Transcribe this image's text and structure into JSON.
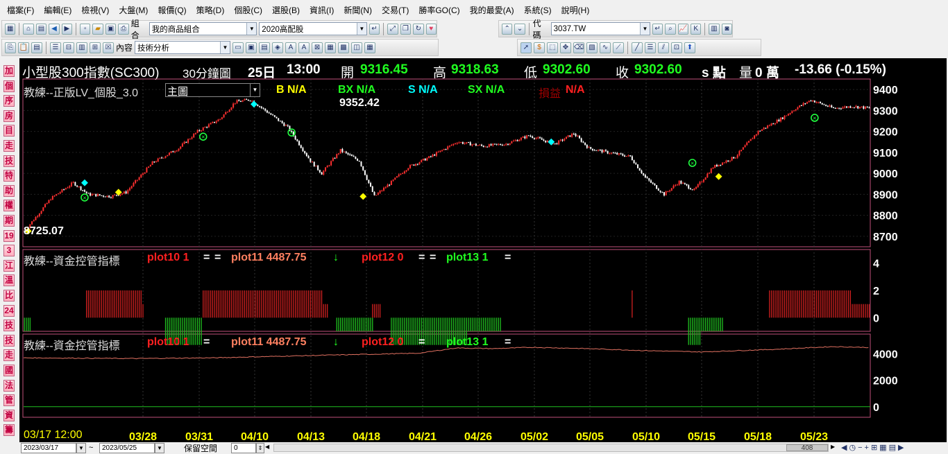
{
  "menu": [
    "檔案(F)",
    "編輯(E)",
    "檢視(V)",
    "大盤(M)",
    "報價(Q)",
    "策略(D)",
    "個股(C)",
    "選股(B)",
    "資訊(I)",
    "新聞(N)",
    "交易(T)",
    "勝率GO(C)",
    "我的最愛(A)",
    "系統(S)",
    "說明(H)"
  ],
  "toolbar": {
    "group_label": "組合",
    "group_value": "我的商品組合",
    "portfolio_value": "2020高配股",
    "code_label": "代碼",
    "code_value": "3037.TW",
    "content_label": "內容",
    "content_value": "技術分析"
  },
  "left_tabs": [
    "加",
    "個",
    "序",
    "房",
    "目",
    "走",
    "技",
    "特",
    "助",
    "權",
    "期",
    "19",
    "3",
    "江",
    "溫",
    "比",
    "24",
    "技",
    "技",
    "走",
    "國",
    "法",
    "管",
    "資",
    "籌"
  ],
  "quote": {
    "name": "小型股300指數(SC300)",
    "period": "30分鐘圖",
    "day": "25日",
    "time": "13:00",
    "open_label": "開",
    "open": "9316.45",
    "high_label": "高",
    "high": "9318.63",
    "low_label": "低",
    "low": "9302.60",
    "close_label": "收",
    "close": "9302.60",
    "unit": "s 點",
    "vol_label": "量",
    "vol": "0 萬",
    "change": "-13.66 (-0.15%)"
  },
  "main_panel": {
    "title": "教練--正版LV_個股_3.0",
    "select": "主圖",
    "b": "B N/A",
    "bx": "BX N/A",
    "s": "S N/A",
    "sx": "SX N/A",
    "pl_label": "損益",
    "pl": "N/A",
    "high_mark": "9352.42",
    "low_mark": "8725.07"
  },
  "ind1": {
    "title": "教練--資金控管指標",
    "p10": "plot10 1",
    "eq": "=",
    "p11": "plot11 4487.75",
    "arrow": "↓",
    "p12": "plot12 0",
    "p13": "plot13 1"
  },
  "ind2": {
    "title": "教練--資金控管指標",
    "p10": "plot10 1",
    "eq": "=",
    "p11": "plot11 4487.75",
    "arrow": "↓",
    "p12": "plot12 0",
    "p13": "plot13 1"
  },
  "axis_main": [
    "9400",
    "9300",
    "9200",
    "9100",
    "9000",
    "8900",
    "8800",
    "8700"
  ],
  "axis_ind1": [
    "4",
    "2",
    "0"
  ],
  "axis_ind2": [
    "4000",
    "2000",
    "0"
  ],
  "xaxis": {
    "first": "03/17 12:00",
    "labels": [
      "03/28",
      "03/31",
      "04/10",
      "04/13",
      "04/18",
      "04/21",
      "04/26",
      "05/02",
      "05/05",
      "05/10",
      "05/15",
      "05/18",
      "05/23"
    ]
  },
  "status": {
    "from": "2023/03/17",
    "tilde": "~",
    "to": "2023/05/25",
    "reserve_label": "保留空間",
    "reserve_value": "0",
    "count": "408"
  },
  "colors": {
    "up": "#ff3030",
    "down": "#ffffff",
    "plot_red": "#ff2020",
    "plot_orange": "#ff8060",
    "plot_green": "#20ff20",
    "buy": "#ffff00",
    "sell": "#00ffff",
    "exit": "#20ff40",
    "pink": "#c0507a"
  },
  "chart_data": {
    "type": "candlestick",
    "ylim": [
      8650,
      9450
    ],
    "key_prices": [
      [
        0,
        8725
      ],
      [
        14,
        8880
      ],
      [
        26,
        8955
      ],
      [
        34,
        8900
      ],
      [
        46,
        8890
      ],
      [
        54,
        8910
      ],
      [
        68,
        9050
      ],
      [
        82,
        9120
      ],
      [
        92,
        9200
      ],
      [
        104,
        9260
      ],
      [
        112,
        9340
      ],
      [
        120,
        9352
      ],
      [
        128,
        9300
      ],
      [
        140,
        9220
      ],
      [
        152,
        9060
      ],
      [
        158,
        9000
      ],
      [
        168,
        9110
      ],
      [
        178,
        9060
      ],
      [
        186,
        8890
      ],
      [
        194,
        8950
      ],
      [
        204,
        9030
      ],
      [
        216,
        9080
      ],
      [
        230,
        9150
      ],
      [
        244,
        9130
      ],
      [
        256,
        9140
      ],
      [
        268,
        9180
      ],
      [
        282,
        9140
      ],
      [
        292,
        9190
      ],
      [
        300,
        9120
      ],
      [
        310,
        9100
      ],
      [
        322,
        9080
      ],
      [
        330,
        8980
      ],
      [
        340,
        8900
      ],
      [
        348,
        8960
      ],
      [
        356,
        8920
      ],
      [
        366,
        9030
      ],
      [
        378,
        9080
      ],
      [
        390,
        9200
      ],
      [
        402,
        9260
      ],
      [
        410,
        9310
      ],
      [
        418,
        9350
      ],
      [
        430,
        9310
      ],
      [
        440,
        9320
      ],
      [
        450,
        9310
      ]
    ],
    "markers": [
      {
        "type": "buy",
        "idx": 2,
        "price": 8725
      },
      {
        "type": "sell",
        "idx": 32,
        "price": 8955
      },
      {
        "type": "exit",
        "idx": 32,
        "price": 8885
      },
      {
        "type": "buy",
        "idx": 50,
        "price": 8910
      },
      {
        "type": "exit",
        "idx": 95,
        "price": 9175
      },
      {
        "type": "sell",
        "idx": 122,
        "price": 9330
      },
      {
        "type": "exit",
        "idx": 142,
        "price": 9195
      },
      {
        "type": "buy",
        "idx": 180,
        "price": 8890
      },
      {
        "type": "sell",
        "idx": 280,
        "price": 9150
      },
      {
        "type": "exit",
        "idx": 355,
        "price": 9050
      },
      {
        "type": "buy",
        "idx": 369,
        "price": 8985
      },
      {
        "type": "exit",
        "idx": 420,
        "price": 9265
      }
    ],
    "ind1": {
      "ylim": [
        -1,
        5
      ],
      "red_runs": [
        [
          33,
          63,
          2
        ],
        [
          63,
          64,
          1
        ],
        [
          95,
          159,
          2
        ],
        [
          159,
          162,
          1
        ],
        [
          185,
          190,
          1
        ],
        [
          323,
          324,
          2
        ],
        [
          396,
          440,
          2
        ],
        [
          440,
          450,
          1
        ]
      ],
      "green_runs": [
        [
          0,
          4,
          -1
        ],
        [
          75,
          95,
          -2
        ],
        [
          166,
          186,
          -1
        ],
        [
          195,
          236,
          -2
        ],
        [
          236,
          254,
          -1
        ],
        [
          353,
          360,
          -2
        ],
        [
          360,
          372,
          -1
        ]
      ]
    },
    "ind2": {
      "ylim": [
        -800,
        5500
      ],
      "equity": [
        [
          0,
          3700
        ],
        [
          60,
          3650
        ],
        [
          100,
          3700
        ],
        [
          160,
          3900
        ],
        [
          210,
          4050
        ],
        [
          230,
          4450
        ],
        [
          250,
          4400
        ],
        [
          270,
          4500
        ],
        [
          300,
          4400
        ],
        [
          330,
          4250
        ],
        [
          360,
          4150
        ],
        [
          400,
          4350
        ],
        [
          430,
          4550
        ],
        [
          450,
          4487
        ]
      ]
    }
  }
}
